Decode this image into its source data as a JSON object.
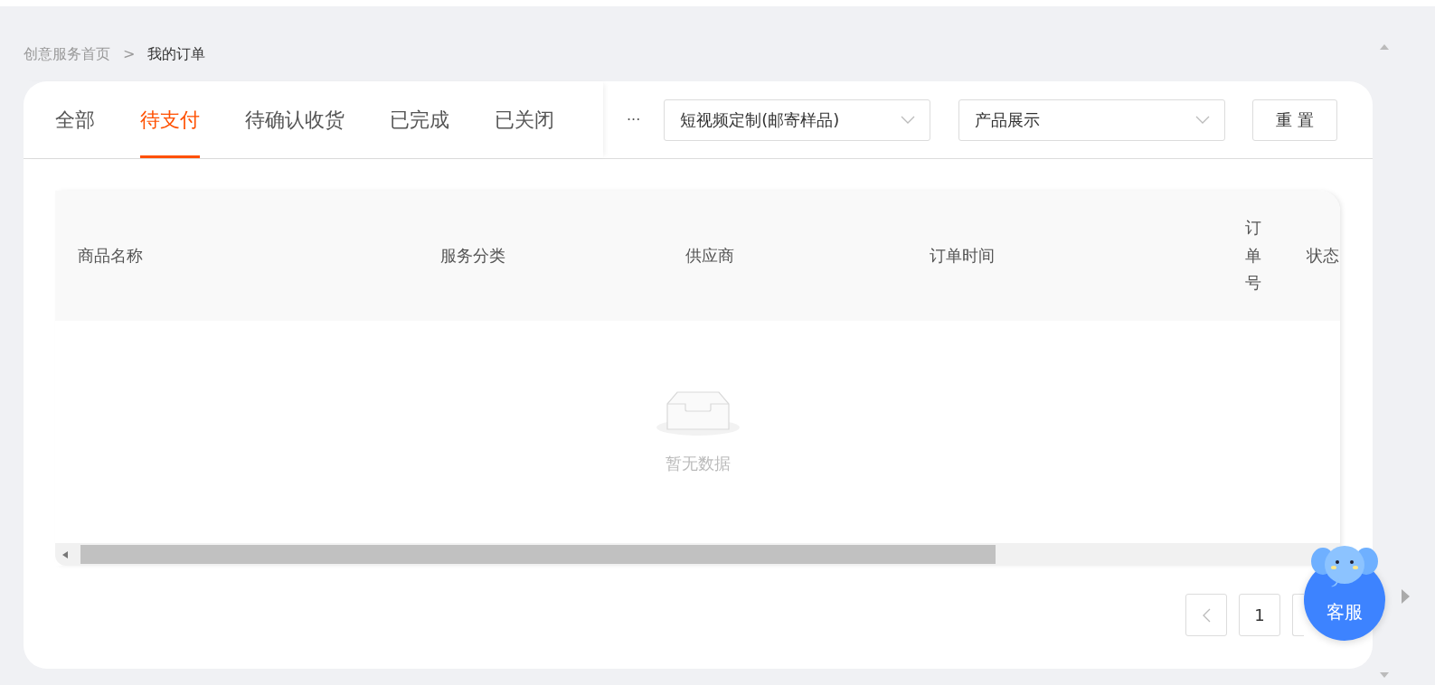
{
  "breadcrumb": {
    "items": [
      {
        "label": "创意服务首页",
        "current": false
      },
      {
        "label": "我的订单",
        "current": true
      }
    ],
    "separator": ">"
  },
  "tabs": [
    {
      "label": "全部",
      "selected": false
    },
    {
      "label": "待支付",
      "selected": true
    },
    {
      "label": "待确认收货",
      "selected": false
    },
    {
      "label": "已完成",
      "selected": false
    },
    {
      "label": "已关闭",
      "selected": false
    }
  ],
  "filters": {
    "more": "···",
    "selects": [
      {
        "value": "短视频定制(邮寄样品)"
      },
      {
        "value": "产品展示"
      }
    ],
    "reset_button": "重 置"
  },
  "table": {
    "columns": [
      {
        "label": "商品名称",
        "kind": "normal"
      },
      {
        "label": "服务分类",
        "kind": "normal"
      },
      {
        "label": "供应商",
        "kind": "normal"
      },
      {
        "label": "订单时间",
        "kind": "normal"
      },
      {
        "label": "订单号",
        "kind": "vertical"
      },
      {
        "label": "状态",
        "kind": "normal"
      }
    ],
    "empty_text": "暂无数据"
  },
  "pagination": {
    "pages": [
      {
        "label": "1",
        "selected": true
      }
    ]
  },
  "chat_button": {
    "label": "客服"
  }
}
